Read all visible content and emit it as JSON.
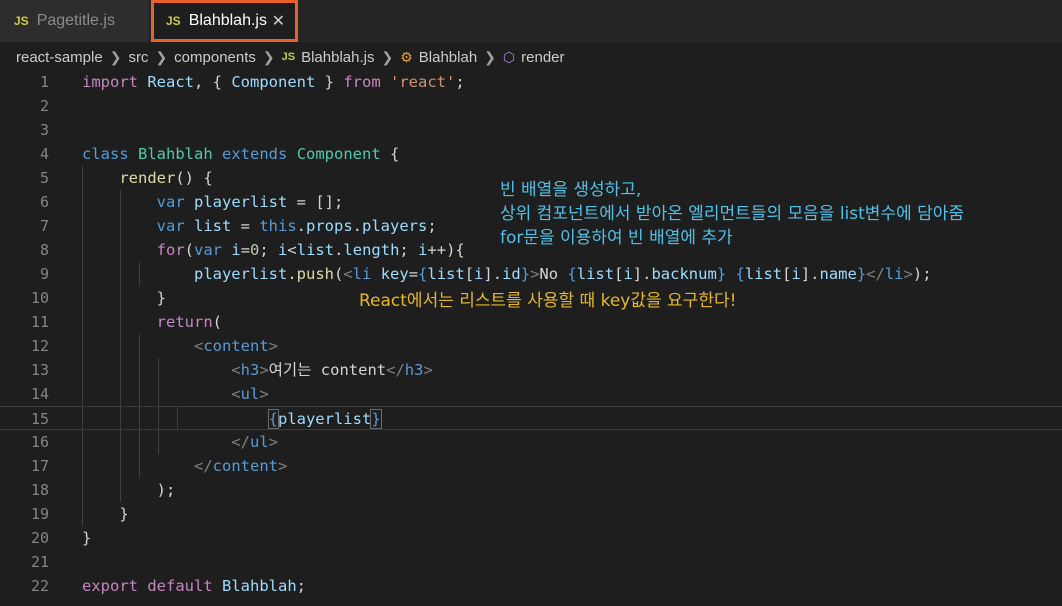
{
  "tabs": [
    {
      "label": "Pagetitle.js",
      "badge": "JS",
      "active": false
    },
    {
      "label": "Blahblah.js",
      "badge": "JS",
      "active": true
    }
  ],
  "breadcrumb": {
    "items": [
      "react-sample",
      "src",
      "components",
      "Blahblah.js",
      "Blahblah",
      "render"
    ],
    "js_badge": "JS"
  },
  "editor": {
    "line_numbers": [
      "1",
      "2",
      "3",
      "4",
      "5",
      "6",
      "7",
      "8",
      "9",
      "10",
      "11",
      "12",
      "13",
      "14",
      "15",
      "16",
      "17",
      "18",
      "19",
      "20",
      "21",
      "22"
    ],
    "current_line": 15
  },
  "annotations": {
    "blue": [
      "빈 배열을 생성하고,",
      "상위 컴포넌트에서 받아온 엘리먼트들의 모음을 list변수에 담아줌",
      "for문을 이용하여 빈 배열에 추가"
    ],
    "orange": "React에서는 리스트를 사용할 때 key값을 요구한다!",
    "colors": {
      "blue": "#4fc1e9",
      "orange": "#e5b827",
      "active_tab_border": "#e8612c"
    }
  }
}
